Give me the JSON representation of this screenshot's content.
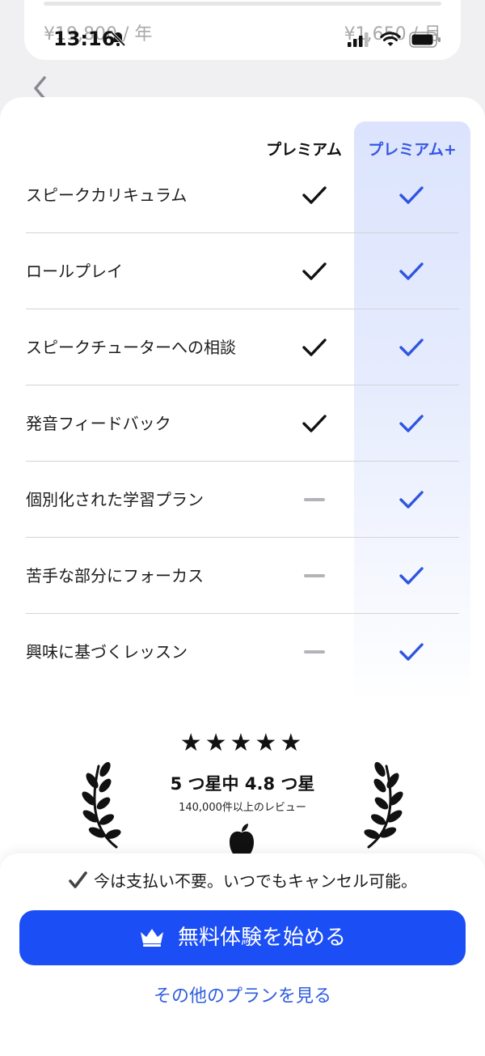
{
  "status_bar": {
    "time": "13:16"
  },
  "background_card": {
    "price_yearly": "¥19,800 / 年",
    "price_monthly": "¥1,650 / 月"
  },
  "comparison": {
    "columns": [
      "プレミアム",
      "プレミアム+"
    ],
    "rows": [
      {
        "feature": "スピークカリキュラム",
        "premium": true,
        "plus": true
      },
      {
        "feature": "ロールプレイ",
        "premium": true,
        "plus": true
      },
      {
        "feature": "スピークチューターへの相談",
        "premium": true,
        "plus": true
      },
      {
        "feature": "発音フィードバック",
        "premium": true,
        "plus": true
      },
      {
        "feature": "個別化された学習プラン",
        "premium": false,
        "plus": true
      },
      {
        "feature": "苦手な部分にフォーカス",
        "premium": false,
        "plus": true
      },
      {
        "feature": "興味に基づくレッスン",
        "premium": false,
        "plus": true
      }
    ]
  },
  "rating": {
    "stars": "★★★★★",
    "headline": "5 つ星中 4.8 つ星",
    "reviews": "140,000件以上のレビュー"
  },
  "footer": {
    "notice": "今は支払い不要。いつでもキャンセル可能。",
    "cta_label": "無料体験を始める",
    "other_plans_label": "その他のプランを見る"
  },
  "icons": {
    "check_premium": "check-icon",
    "check_plus": "check-icon",
    "not_included": "dash-icon",
    "back": "chevron-left-icon",
    "crown": "crown-icon",
    "apple": "apple-logo-icon",
    "laurel": "laurel-icon"
  },
  "colors": {
    "accent": "#1c4ef6",
    "plus_header": "#3657e4",
    "plus_check": "#2f55e0",
    "column_highlight": "#dce4fd"
  }
}
